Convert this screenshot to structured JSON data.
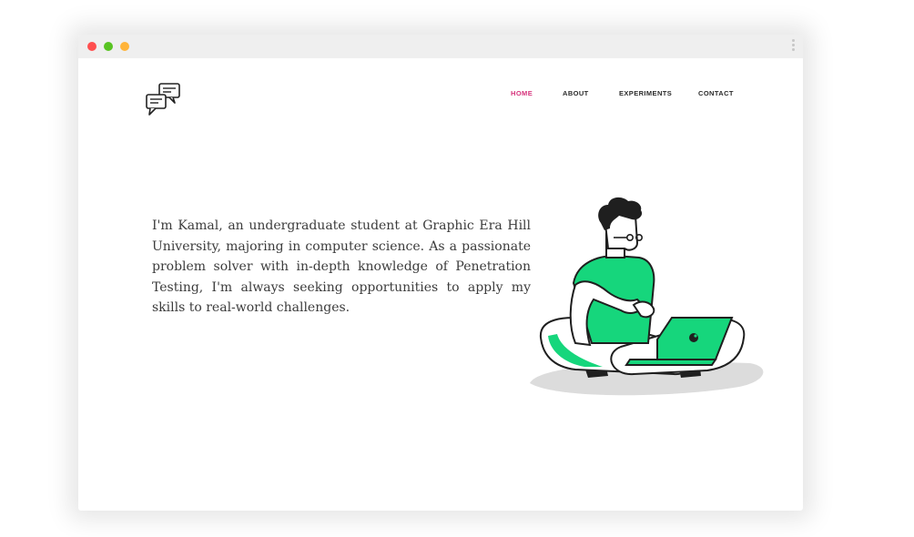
{
  "window": {
    "controls": {
      "close_color": "#ff4f4f",
      "minimize_color": "#58c322",
      "maximize_color": "#ffb43a"
    }
  },
  "header": {
    "logo_icon": "chat-bubbles-icon",
    "nav": [
      {
        "label": "HOME",
        "active": true
      },
      {
        "label": "ABOUT",
        "active": false
      },
      {
        "label": "EXPERIMENTS",
        "active": false
      },
      {
        "label": "CONTACT",
        "active": false
      }
    ]
  },
  "main": {
    "intro_text": "I'm Kamal, an undergraduate student at Graphic Era Hill University, majoring in computer science. As a passionate problem solver with in-depth knowledge of Penetration Testing, I'm always seeking opportunities to apply my skills to real-world challenges.",
    "illustration_icon": "person-with-laptop-illustration"
  },
  "colors": {
    "accent": "#d6347c",
    "illustration_green": "#16d67c",
    "text": "#3c3c3c",
    "titlebar": "#efefef"
  }
}
